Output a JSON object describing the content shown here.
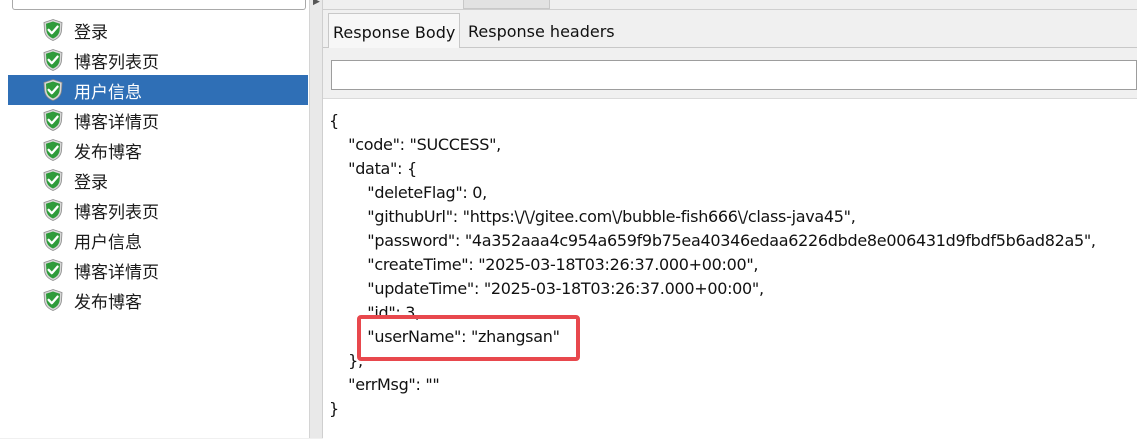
{
  "tree": {
    "items": [
      {
        "label": "登录",
        "status": "success",
        "selected": false
      },
      {
        "label": "博客列表页",
        "status": "success",
        "selected": false
      },
      {
        "label": "用户信息",
        "status": "success",
        "selected": true
      },
      {
        "label": "博客详情页",
        "status": "success",
        "selected": false
      },
      {
        "label": "发布博客",
        "status": "success",
        "selected": false
      },
      {
        "label": "登录",
        "status": "success",
        "selected": false
      },
      {
        "label": "博客列表页",
        "status": "success",
        "selected": false
      },
      {
        "label": "用户信息",
        "status": "success",
        "selected": false
      },
      {
        "label": "博客详情页",
        "status": "success",
        "selected": false
      },
      {
        "label": "发布博客",
        "status": "success",
        "selected": false
      }
    ]
  },
  "tabs": [
    {
      "label": "Response Body",
      "active": true
    },
    {
      "label": "Response headers",
      "active": false
    }
  ],
  "search": {
    "value": ""
  },
  "response": {
    "lines": [
      "{",
      "    \"code\": \"SUCCESS\",",
      "    \"data\": {",
      "        \"deleteFlag\": 0,",
      "        \"githubUrl\": \"https:\\/\\/gitee.com\\/bubble-fish666\\/class-java45\",",
      "        \"password\": \"4a352aaa4c954a659f9b75ea40346edaa6226dbde8e006431d9fbdf5b6ad82a5\",",
      "        \"createTime\": \"2025-03-18T03:26:37.000+00:00\",",
      "        \"updateTime\": \"2025-03-18T03:26:37.000+00:00\",",
      "        \"id\": 3,",
      "        \"userName\": \"zhangsan\"",
      "    },",
      "    \"errMsg\": \"\"",
      "}"
    ]
  },
  "colors": {
    "selection": "#2f6fb6",
    "success_shield": "#2e9b3a",
    "highlight_box": "#e8484d"
  }
}
